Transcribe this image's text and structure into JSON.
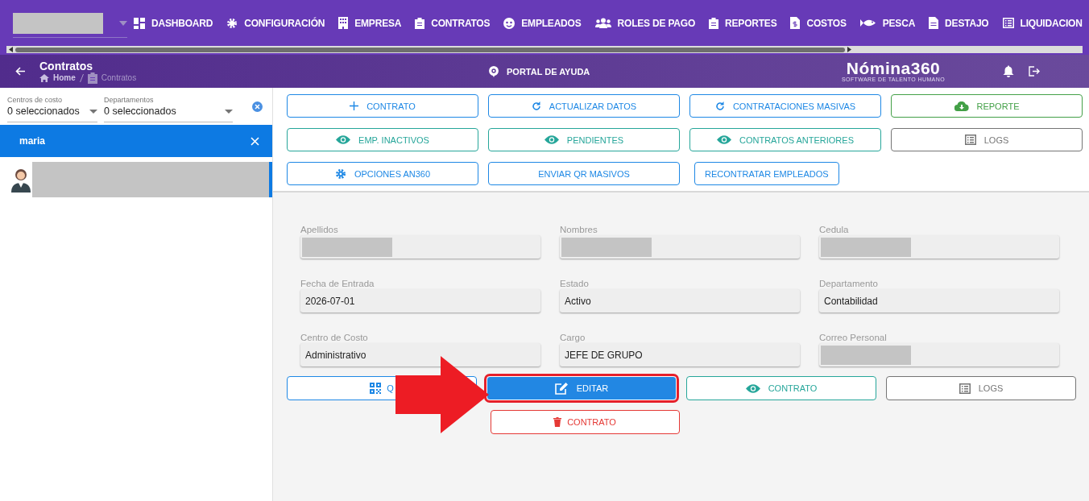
{
  "top_nav": {
    "company_select": {
      "redacted": true
    },
    "items": [
      {
        "label": "DASHBOARD"
      },
      {
        "label": "CONFIGURACIÓN"
      },
      {
        "label": "EMPRESA"
      },
      {
        "label": "CONTRATOS"
      },
      {
        "label": "EMPLEADOS"
      },
      {
        "label": "ROLES DE PAGO"
      },
      {
        "label": "REPORTES"
      },
      {
        "label": "COSTOS"
      },
      {
        "label": "PESCA"
      },
      {
        "label": "DESTAJO"
      },
      {
        "label": "LIQUIDACION"
      }
    ]
  },
  "header": {
    "title": "Contratos",
    "breadcrumb": [
      "Home",
      "Contratos"
    ],
    "help_link": "PORTAL DE AYUDA",
    "logo": {
      "name": "Nómina360",
      "tagline": "SOFTWARE DE TALENTO HUMANO"
    }
  },
  "filters": [
    {
      "label": "Centros de costo",
      "value": "0 seleccionados"
    },
    {
      "label": "Departamentos",
      "value": "0 seleccionados"
    }
  ],
  "search_chip": "maria",
  "employees": [
    {
      "redacted": true,
      "selected": true
    }
  ],
  "toolbar_buttons": [
    {
      "label": "CONTRATO",
      "kind": "primary"
    },
    {
      "label": "ACTUALIZAR DATOS",
      "kind": "primary"
    },
    {
      "label": "CONTRATACIONES MASIVAS",
      "kind": "primary"
    },
    {
      "label": "REPORTE",
      "kind": "success"
    },
    {
      "label": "EMP. INACTIVOS",
      "kind": "teal"
    },
    {
      "label": "PENDIENTES",
      "kind": "teal"
    },
    {
      "label": "CONTRATOS ANTERIORES",
      "kind": "teal"
    },
    {
      "label": "LOGS",
      "kind": "grey"
    },
    {
      "label": "OPCIONES AN360",
      "kind": "primary"
    },
    {
      "label": "ENVIAR QR MASIVOS",
      "kind": "primary"
    },
    {
      "label": "RECONTRATAR EMPLEADOS",
      "kind": "primary"
    }
  ],
  "fields": [
    {
      "label": "Apellidos",
      "redacted": true
    },
    {
      "label": "Nombres",
      "redacted": true
    },
    {
      "label": "Cedula",
      "redacted": true
    },
    {
      "label": "Fecha de Entrada",
      "value": "2026-07-01"
    },
    {
      "label": "Estado",
      "value": "Activo"
    },
    {
      "label": "Departamento",
      "value": "Contabilidad"
    },
    {
      "label": "Centro de Costo",
      "value": "Administrativo"
    },
    {
      "label": "Cargo",
      "value": "JEFE DE GRUPO"
    },
    {
      "label": "Correo Personal",
      "redacted": true
    }
  ],
  "action_buttons": [
    {
      "label": "Q",
      "kind": "primary",
      "highlighted": false
    },
    {
      "label": "EDITAR",
      "kind": "filled",
      "highlighted": true
    },
    {
      "label": "CONTRATO",
      "kind": "teal",
      "highlighted": false
    },
    {
      "label": "LOGS",
      "kind": "grey",
      "highlighted": false
    }
  ],
  "delete_button": {
    "label": "CONTRATO",
    "kind": "danger"
  },
  "annotation": {
    "kind": "arrow"
  }
}
